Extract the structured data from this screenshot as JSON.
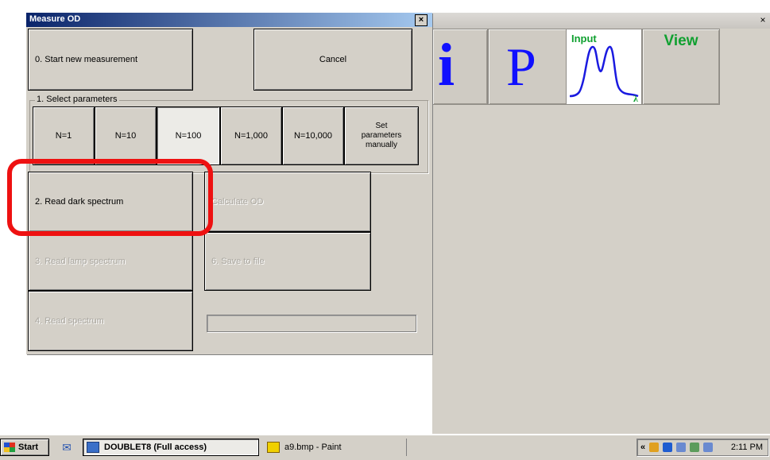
{
  "dialog": {
    "title": "Measure OD",
    "close_glyph": "×",
    "start_new_label": "0. Start new measurement",
    "cancel_label": "Cancel",
    "group_label": "1. Select parameters",
    "parameter_buttons": [
      "N=1",
      "N=10",
      "N=100",
      "N=1,000",
      "N=10,000",
      "Set parameters manually"
    ],
    "selected_parameter": "N=100",
    "read_dark_label": "2. Read dark spectrum",
    "read_lamp_label": "3. Read lamp spectrum",
    "read_spectrum_label": "4. Read spectrum",
    "calculate_label": "Calculate OD",
    "save_label": "6. Save to file",
    "progress_value": 0,
    "highlight_color": "#ee1111"
  },
  "main_window": {
    "close_glyph": "×",
    "toolbar": {
      "info_glyph": "i",
      "p_glyph": "P",
      "input_label": "Input",
      "input_icon": "spectrum-graph-icon",
      "view_label": "View"
    }
  },
  "taskbar": {
    "start_label": "Start",
    "tasks": [
      "DOUBLET8 (Full access)",
      "a9.bmp - Paint"
    ],
    "tray_arrow": "«",
    "clock": "2:11 PM"
  },
  "colors": {
    "title_active": "#0a246a",
    "accent_blue": "#1010ff",
    "accent_green": "#10a030"
  }
}
